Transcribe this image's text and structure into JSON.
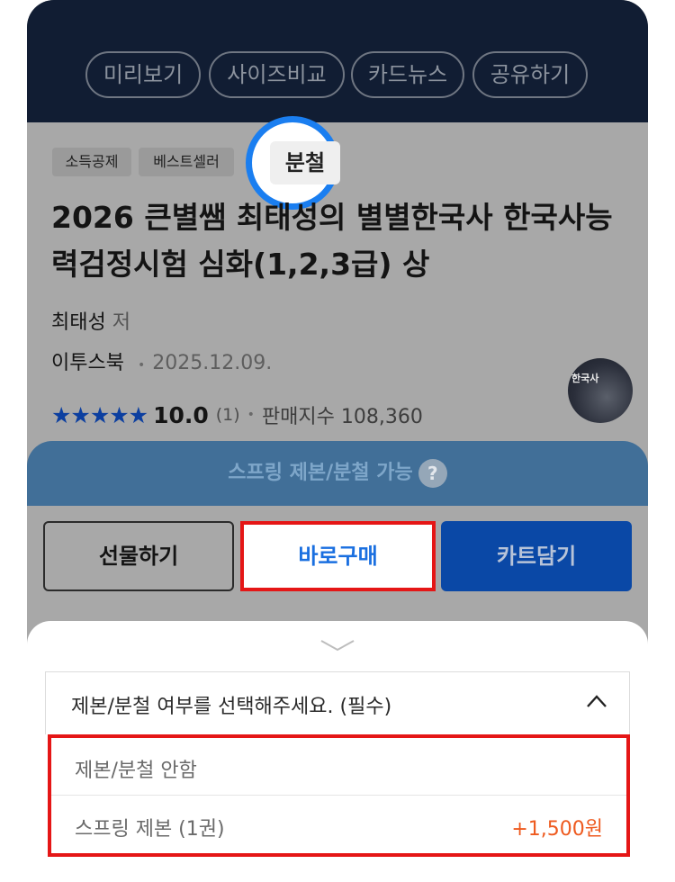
{
  "top_actions": [
    "미리보기",
    "사이즈비교",
    "카드뉴스",
    "공유하기"
  ],
  "tags": [
    "소득공제",
    "베스트셀러",
    "분철"
  ],
  "book": {
    "title": "2026 큰별쌤 최태성의 별별한국사 한국사능력검정시험 심화(1,2,3급) 상",
    "author": "최태성",
    "author_suffix": "저",
    "publisher": "이투스북",
    "date": "2025.12.09.",
    "stars": "★★★★★",
    "score": "10.0",
    "review_count": "(1)",
    "sales_label": "판매지수 108,360",
    "avatar_text": "한국사"
  },
  "spring_banner": {
    "label": "스프링 제본/분철 가능",
    "help_icon": "?"
  },
  "buttons": {
    "gift": "선물하기",
    "buy_now": "바로구매",
    "cart": "카트담기"
  },
  "option_sheet": {
    "select_label": "제본/분철 여부를 선택해주세요. (필수)",
    "options": [
      {
        "name": "제본/분철 안함",
        "price": ""
      },
      {
        "name": "스프링 제본 (1권)",
        "price": "+1,500원"
      }
    ]
  },
  "colors": {
    "header_bg": "#111d33",
    "highlight_ring": "#1a7ef0",
    "highlight_box": "#e51616",
    "buy_text": "#1a6fe0",
    "cart_bg": "#0a48a6",
    "price_orange": "#ee5a1f",
    "star_blue": "#0c3fa0"
  }
}
